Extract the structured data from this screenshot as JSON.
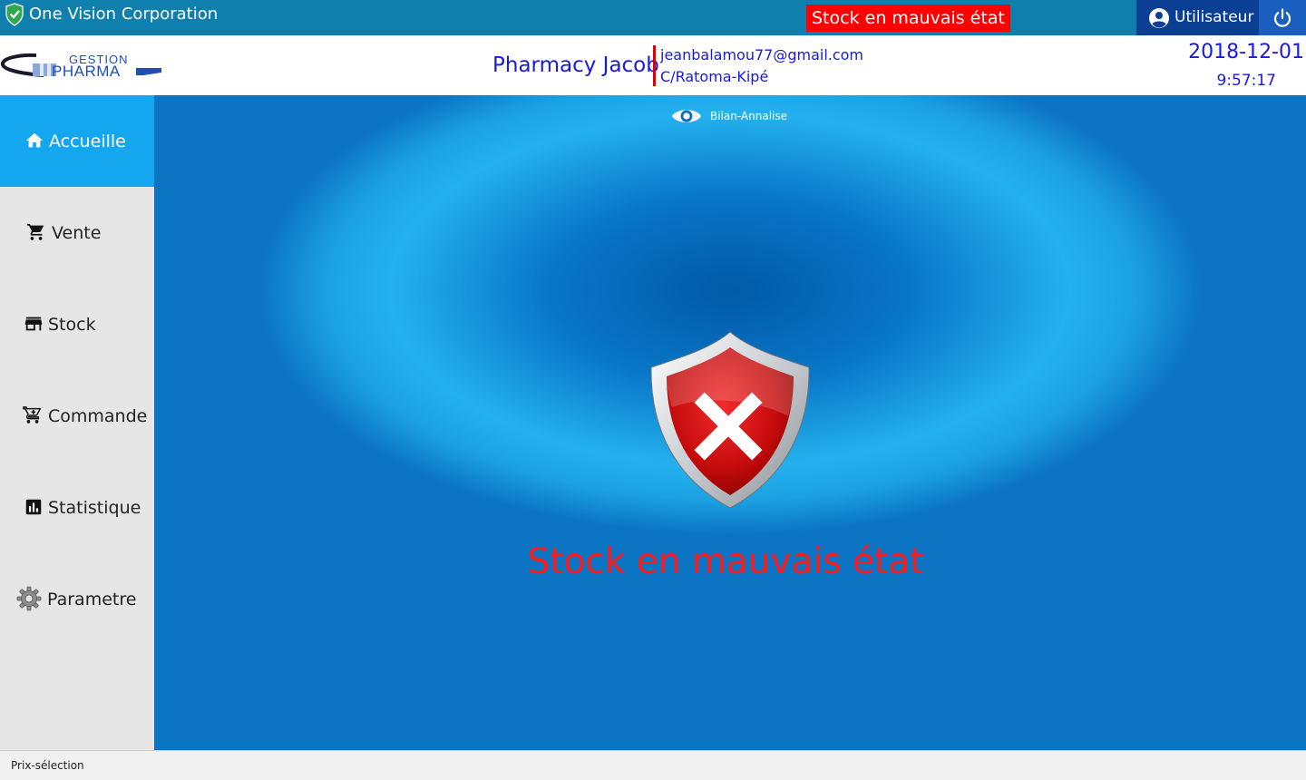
{
  "titlebar": {
    "app_title": "One Vision Corporation",
    "alert": "Stock en mauvais état",
    "user_label": "Utilisateur",
    "logo_icon": "shield-check-icon",
    "power_icon": "power-icon",
    "user_icon": "account-circle-icon"
  },
  "header": {
    "logo_top": "GESTION",
    "logo_bottom": "PHARMA",
    "pharmacy_name": "Pharmacy Jacob",
    "email": "jeanbalamou77@gmail.com",
    "address": "C/Ratoma-Kipé",
    "date": "2018-12-01",
    "time": "9:57:17"
  },
  "sidebar": {
    "items": [
      {
        "label": "Accueille",
        "icon": "home-icon",
        "active": true
      },
      {
        "label": "Vente",
        "icon": "cart-icon",
        "active": false
      },
      {
        "label": "Stock",
        "icon": "store-icon",
        "active": false
      },
      {
        "label": "Commande",
        "icon": "cart-plus-icon",
        "active": false
      },
      {
        "label": "Statistique",
        "icon": "chart-icon",
        "active": false
      },
      {
        "label": "Parametre",
        "icon": "gear-icon",
        "active": false
      }
    ]
  },
  "main": {
    "view_label": "Bilan-Annalise",
    "status_message": "Stock en mauvais état"
  },
  "statusbar": {
    "text": "Prix-sélection"
  },
  "colors": {
    "titlebar": "#0f7fae",
    "alert_bg": "#ff0000",
    "header_text": "#1a1adc",
    "active_nav": "#14a6ee",
    "status_message": "#ff1a1a"
  }
}
